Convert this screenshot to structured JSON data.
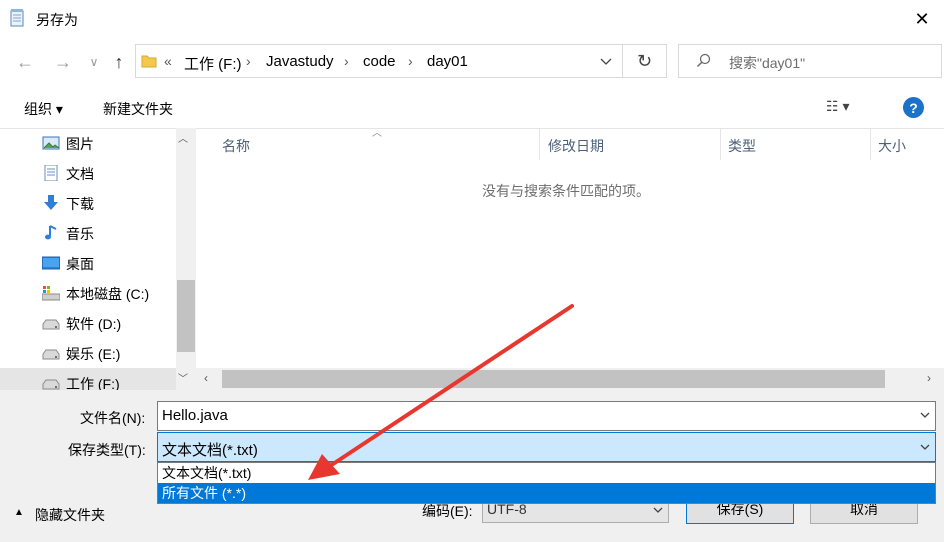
{
  "window": {
    "title": "另存为",
    "close_glyph": "✕"
  },
  "nav": {
    "back_glyph": "←",
    "forward_glyph": "→",
    "recent_glyph": "∨",
    "up_glyph": "↑",
    "breadcrumb_prefix": "«",
    "breadcrumb": [
      "工作 (F:)",
      "Javastudy",
      "code",
      "day01"
    ],
    "refresh_glyph": "↻",
    "search_placeholder": "搜索\"day01\""
  },
  "toolbar": {
    "organize_label": "组织 ▾",
    "new_folder_label": "新建文件夹",
    "view_glyph": "☷ ▾",
    "help_glyph": "?"
  },
  "sidebar": {
    "items": [
      {
        "label": "图片",
        "icon": "pictures-icon"
      },
      {
        "label": "文档",
        "icon": "documents-icon"
      },
      {
        "label": "下载",
        "icon": "downloads-icon"
      },
      {
        "label": "音乐",
        "icon": "music-icon"
      },
      {
        "label": "桌面",
        "icon": "desktop-icon"
      },
      {
        "label": "本地磁盘 (C:)",
        "icon": "system-drive-icon"
      },
      {
        "label": "软件 (D:)",
        "icon": "drive-icon"
      },
      {
        "label": "娱乐 (E:)",
        "icon": "drive-icon"
      },
      {
        "label": "工作 (F:)",
        "icon": "drive-icon"
      }
    ]
  },
  "filelist": {
    "columns": [
      "名称",
      "修改日期",
      "类型",
      "大小"
    ],
    "empty_message": "没有与搜索条件匹配的项。"
  },
  "form": {
    "filename_label": "文件名(N):",
    "filename_value": "Hello.java",
    "filetype_label": "保存类型(T):",
    "filetype_value": "文本文档(*.txt)",
    "filetype_options": [
      "文本文档(*.txt)",
      "所有文件  (*.*)"
    ],
    "encoding_label": "编码(E):",
    "encoding_value": "UTF-8"
  },
  "footer": {
    "hide_folders_label": "隐藏文件夹",
    "save_label": "保存(S)",
    "cancel_label": "取消"
  },
  "colors": {
    "accent": "#0078d7",
    "selection": "#cce8ff",
    "annotation_arrow": "#e8372e"
  }
}
